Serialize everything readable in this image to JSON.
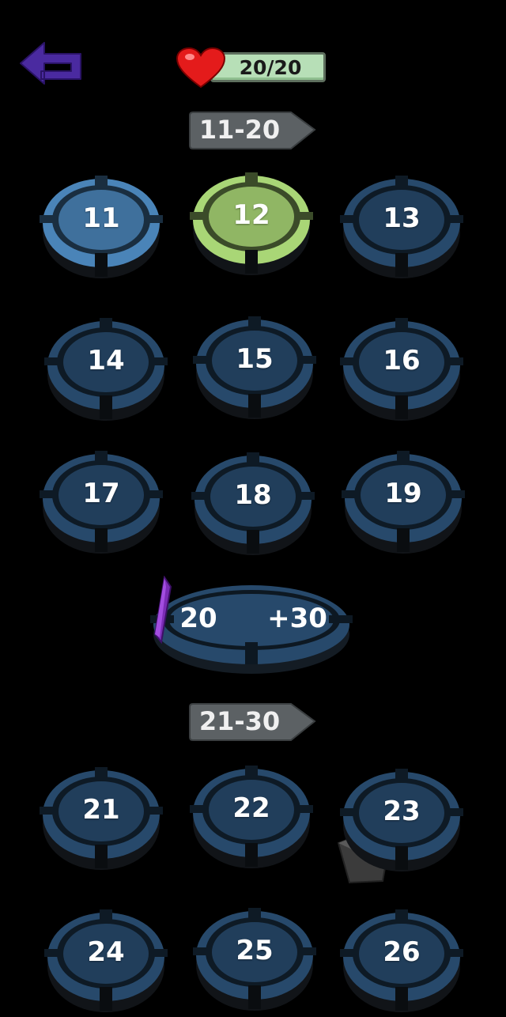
{
  "header": {
    "health_text": "20/20"
  },
  "sections": [
    {
      "label": "11-20"
    },
    {
      "label": "21-30"
    }
  ],
  "levels": [
    {
      "label": "11",
      "state": "completed",
      "color": "#4a84b8"
    },
    {
      "label": "12",
      "state": "current",
      "color": "#a9d676"
    },
    {
      "label": "13",
      "state": "locked",
      "color": "#27496b"
    },
    {
      "label": "14",
      "state": "locked",
      "color": "#27496b"
    },
    {
      "label": "15",
      "state": "locked",
      "color": "#27496b"
    },
    {
      "label": "16",
      "state": "locked",
      "color": "#27496b"
    },
    {
      "label": "17",
      "state": "locked",
      "color": "#27496b"
    },
    {
      "label": "18",
      "state": "locked",
      "color": "#27496b"
    },
    {
      "label": "19",
      "state": "locked",
      "color": "#27496b"
    },
    {
      "label": "21",
      "state": "locked",
      "color": "#27496b"
    },
    {
      "label": "22",
      "state": "locked",
      "color": "#27496b"
    },
    {
      "label": "23",
      "state": "locked",
      "color": "#27496b"
    },
    {
      "label": "24",
      "state": "locked",
      "color": "#27496b"
    },
    {
      "label": "25",
      "state": "locked",
      "color": "#27496b"
    },
    {
      "label": "26",
      "state": "locked",
      "color": "#27496b"
    }
  ],
  "bonus_level": {
    "level": "20",
    "reward": "+30"
  },
  "icons": {
    "back": "back-arrow-icon",
    "health": "heart-icon",
    "reward": "crystal-icon"
  },
  "colors": {
    "background": "#000000",
    "locked": "#27496b",
    "completed": "#4a84b8",
    "current": "#a9d676",
    "back_arrow": "#4a2aa0",
    "health_bar": "#b7dfb7"
  }
}
